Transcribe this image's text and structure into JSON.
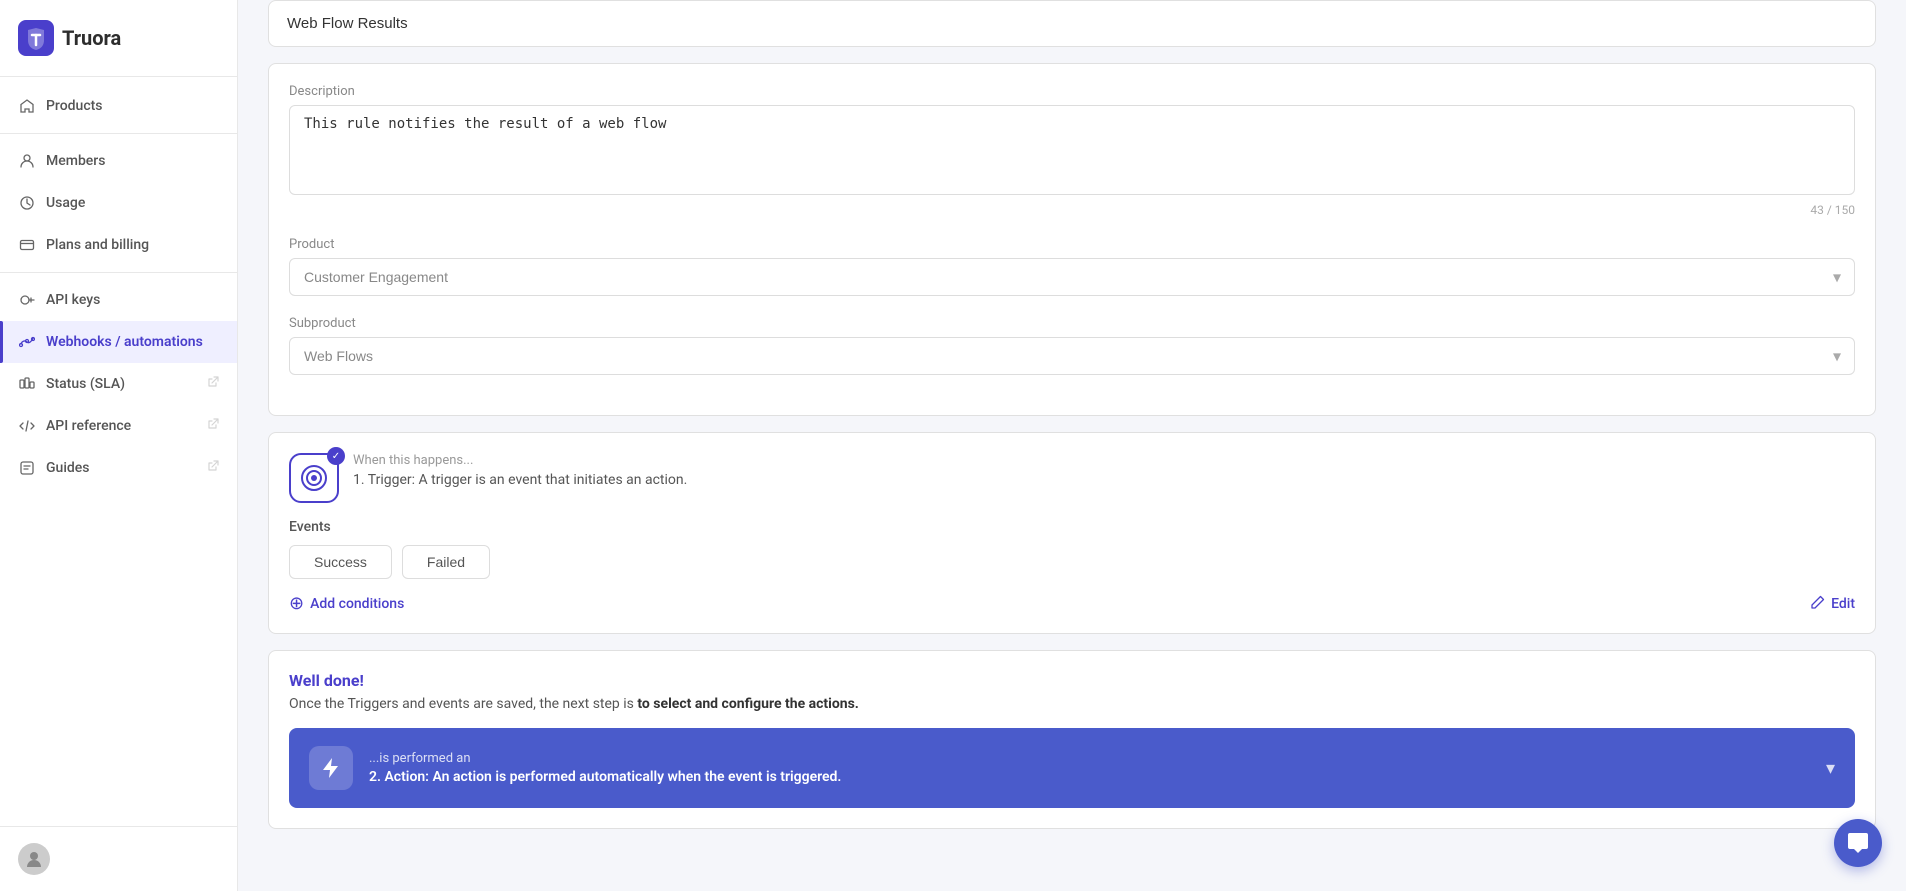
{
  "brand": {
    "logo_text": "Truora",
    "logo_color": "#4a3fcb"
  },
  "sidebar": {
    "items": [
      {
        "id": "products",
        "label": "Products",
        "icon": "home-icon",
        "active": false,
        "external": false
      },
      {
        "id": "members",
        "label": "Members",
        "icon": "members-icon",
        "active": false,
        "external": false
      },
      {
        "id": "usage",
        "label": "Usage",
        "icon": "usage-icon",
        "active": false,
        "external": false
      },
      {
        "id": "plans-billing",
        "label": "Plans and billing",
        "icon": "billing-icon",
        "active": false,
        "external": false
      },
      {
        "id": "api-keys",
        "label": "API keys",
        "icon": "api-keys-icon",
        "active": false,
        "external": false
      },
      {
        "id": "webhooks",
        "label": "Webhooks / automations",
        "icon": "webhooks-icon",
        "active": true,
        "external": false
      },
      {
        "id": "status-sla",
        "label": "Status (SLA)",
        "icon": "status-icon",
        "active": false,
        "external": true
      },
      {
        "id": "api-reference",
        "label": "API reference",
        "icon": "api-ref-icon",
        "active": false,
        "external": true
      },
      {
        "id": "guides",
        "label": "Guides",
        "icon": "guides-icon",
        "active": false,
        "external": true
      }
    ]
  },
  "form": {
    "name_placeholder": "Web Flow Results",
    "name_value": "Web Flow Results",
    "description_label": "Description",
    "description_value": "This rule notifies the result of a web flow",
    "description_char_count": "43 / 150",
    "product_label": "Product",
    "product_placeholder": "Customer Engagement",
    "product_options": [
      "Customer Engagement"
    ],
    "subproduct_label": "Subproduct",
    "subproduct_placeholder": "Web Flows",
    "subproduct_options": [
      "Web Flows"
    ]
  },
  "trigger": {
    "subtitle": "When this happens...",
    "description": "1. Trigger: A trigger is an event that initiates an action.",
    "events_label": "Events",
    "success_label": "Success",
    "failed_label": "Failed",
    "add_conditions_label": "Add conditions",
    "edit_label": "Edit"
  },
  "well_done": {
    "title": "Well done!",
    "text_before": "Once the Triggers and events are saved, the next step is ",
    "text_bold": "to select and configure the actions.",
    "text_after": ""
  },
  "action": {
    "subtitle": "...is performed an",
    "description": "2. Action: An action is performed automatically when the event is triggered."
  },
  "chat": {
    "icon": "💬"
  }
}
